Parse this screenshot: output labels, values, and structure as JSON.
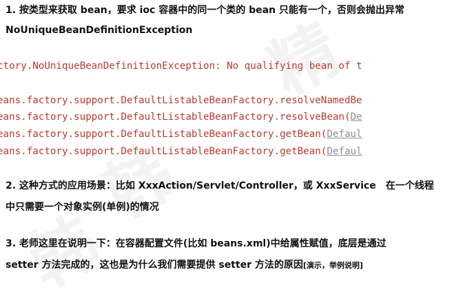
{
  "point1": {
    "line1": "1. 按类型来获取 bean，要求 ioc 容器中的同一个类的 bean 只能有一个，否则会抛出异常",
    "line2": "NoUniqueBeanDefinitionException"
  },
  "code_lines": [
    {
      "text": "ctory.NoUniqueBeanDefinitionException: No qualifying bean of t",
      "link": ""
    },
    {
      "text": "eans.factory.support.DefaultListableBeanFactory.resolveNamedBe",
      "link": ""
    },
    {
      "text": "eans.factory.support.DefaultListableBeanFactory.resolveBean(",
      "link": "De"
    },
    {
      "text": "eans.factory.support.DefaultListableBeanFactory.getBean(",
      "link": "Defaul"
    },
    {
      "text": "eans.factory.support.DefaultListableBeanFactory.getBean(",
      "link": "Defaul"
    }
  ],
  "point2": {
    "line1": "2. 这种方式的应用场景：比如 XxxAction/Servlet/Controller，或 XxxService　在一个线程",
    "line2": "中只需要一个对象实例(单例)的情况"
  },
  "point3": {
    "line1": "3. 老师这里在说明一下：在容器配置文件(比如 beans.xml)中给属性赋值，底层是通过",
    "line2": "setter 方法完成的，这也是为什么我们需要提供 setter 方法的原因",
    "note": "[演示，举例说明]"
  },
  "watermark_text": "韩顺平教育",
  "colors": {
    "code_red": "#c0392b",
    "link_gray": "#8a8f99"
  }
}
